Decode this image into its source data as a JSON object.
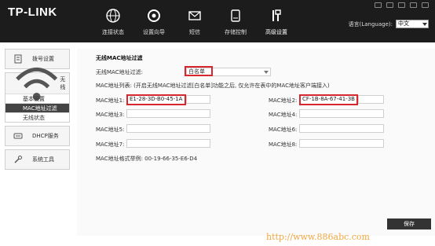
{
  "header": {
    "logo": "TP-LINK",
    "nav": [
      {
        "label": "连接状态",
        "icon": "globe-icon"
      },
      {
        "label": "设置向导",
        "icon": "wizard-icon"
      },
      {
        "label": "短信",
        "icon": "mail-icon"
      },
      {
        "label": "存储控制",
        "icon": "storage-icon"
      },
      {
        "label": "高级设置",
        "icon": "tools-icon"
      }
    ],
    "language_label": "语言(Language):",
    "language_value": "中文"
  },
  "sidebar": {
    "items": [
      {
        "label": "拨号设置",
        "icon": "dialup-icon"
      },
      {
        "label": "无线",
        "icon": "wifi-icon"
      },
      {
        "label": "DHCP服务",
        "icon": "dhcp-icon"
      },
      {
        "label": "系统工具",
        "icon": "wrench-icon"
      }
    ],
    "wireless_sub": [
      {
        "label": "基本设置"
      },
      {
        "label": "MAC地址过滤"
      },
      {
        "label": "无线状态"
      }
    ]
  },
  "main": {
    "title": "无线MAC地址过滤",
    "filter_label": "无线MAC地址过滤:",
    "filter_value": "白名单",
    "list_note": "MAC地址列表: (开启无线MAC地址过滤[白名单]功能之后, 仅允许在表中的MAC地址客户端接入)",
    "macs": [
      {
        "label": "MAC地址1:",
        "value": "E1-28-3D-B0-45-1A"
      },
      {
        "label": "MAC地址2:",
        "value": "CF-1B-8A-67-41-3B"
      },
      {
        "label": "MAC地址3:",
        "value": ""
      },
      {
        "label": "MAC地址4:",
        "value": ""
      },
      {
        "label": "MAC地址5:",
        "value": ""
      },
      {
        "label": "MAC地址6:",
        "value": ""
      },
      {
        "label": "MAC地址7:",
        "value": ""
      },
      {
        "label": "MAC地址8:",
        "value": ""
      }
    ],
    "format_example": "MAC地址格式举例: 00-19-66-35-E6-D4",
    "save_label": "保存"
  },
  "watermark": "http://www.886abc.com",
  "colors": {
    "highlight": "#d8262e",
    "topbar": "#1c1c1c",
    "watermark": "#f1a640"
  }
}
